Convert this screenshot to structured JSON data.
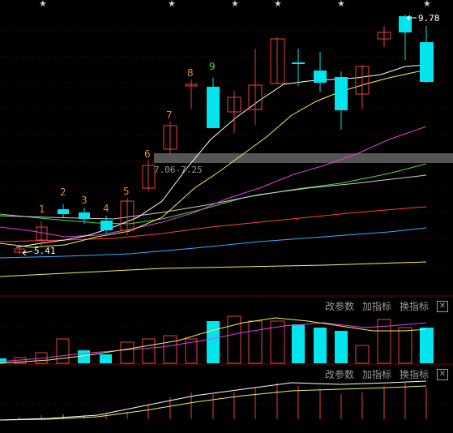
{
  "top_stars": [
    "★",
    "★",
    "★",
    "★",
    "★",
    "★"
  ],
  "price_labels": {
    "high": "9.78",
    "low": "5.41"
  },
  "range_label": "7.06-7.25",
  "sequence_labels": [
    {
      "text": "1",
      "color": "#e88a2a"
    },
    {
      "text": "2",
      "color": "#e88a2a"
    },
    {
      "text": "3",
      "color": "#e88a2a"
    },
    {
      "text": "4",
      "color": "#e88a2a"
    },
    {
      "text": "5",
      "color": "#e88a2a"
    },
    {
      "text": "6",
      "color": "#e88a2a"
    },
    {
      "text": "7",
      "color": "#e88a2a"
    },
    {
      "text": "8",
      "color": "#e88a2a"
    },
    {
      "text": "9",
      "color": "#44dd22"
    }
  ],
  "panel2_toolbar": {
    "change_params": "改参数",
    "add_indicator": "加指标",
    "switch_indicator": "换指标",
    "close": "✕"
  },
  "panel3_toolbar": {
    "change_params": "改参数",
    "add_indicator": "加指标",
    "switch_indicator": "换指标",
    "close": "✕"
  },
  "colors": {
    "up": "#e5453a",
    "down": "#00e5ee",
    "ma_white": "#e8e8e8",
    "ma_yellow": "#f0f060",
    "ma_magenta": "#e040e0",
    "ma_green": "#40e040",
    "ma_red": "#ff4040",
    "ma_cyan": "#30b0ff",
    "band": "#555555"
  }
}
